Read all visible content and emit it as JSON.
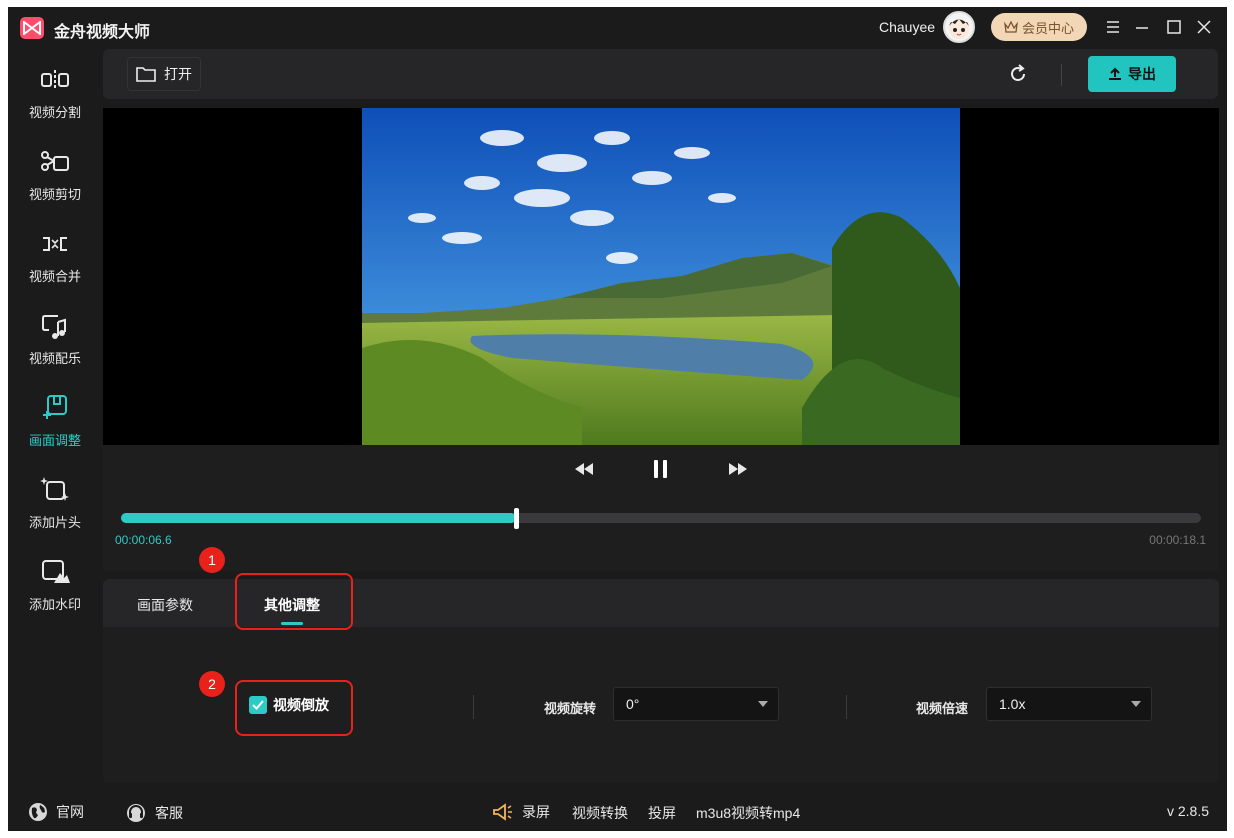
{
  "app": {
    "title": "金舟视频大师",
    "username": "Chauyee",
    "member_label": "会员中心",
    "accent_color": "#2ccbc6"
  },
  "sidebar": {
    "items": [
      {
        "label": "视频分割",
        "icon": "split-icon"
      },
      {
        "label": "视频剪切",
        "icon": "scissors-icon"
      },
      {
        "label": "视频合并",
        "icon": "merge-icon"
      },
      {
        "label": "视频配乐",
        "icon": "music-icon"
      },
      {
        "label": "画面调整",
        "icon": "adjust-icon"
      },
      {
        "label": "添加片头",
        "icon": "intro-icon"
      },
      {
        "label": "添加水印",
        "icon": "watermark-icon"
      }
    ],
    "active_index": 4
  },
  "toolbar": {
    "open_label": "打开",
    "export_label": "导出"
  },
  "player": {
    "current_time": "00:00:06.6",
    "total_time": "00:00:18.1",
    "progress": 0.366
  },
  "panel": {
    "tabs": [
      "画面参数",
      "其他调整"
    ],
    "active_tab": 1,
    "reverse_label": "视频倒放",
    "reverse_checked": true,
    "rotate_label": "视频旋转",
    "rotate_value": "0°",
    "speed_label": "视频倍速",
    "speed_value": "1.0x"
  },
  "annotations": [
    "1",
    "2"
  ],
  "footer": {
    "website_label": "官网",
    "support_label": "客服",
    "links": [
      "录屏",
      "视频转换",
      "投屏",
      "m3u8视频转mp4"
    ],
    "version": "v 2.8.5"
  }
}
